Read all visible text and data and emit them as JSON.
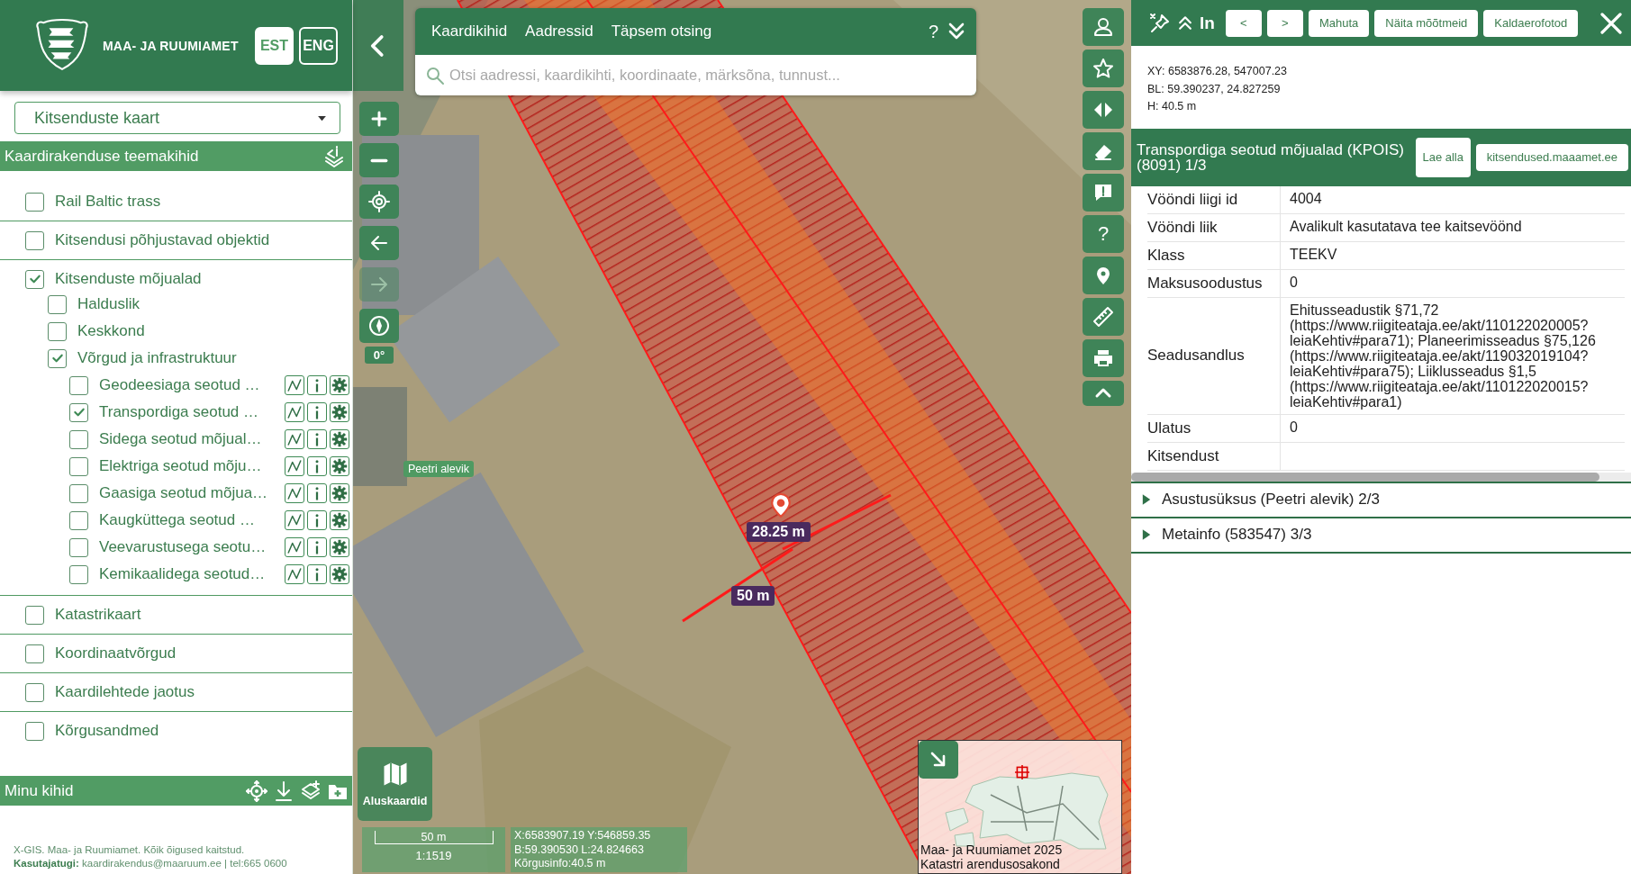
{
  "header": {
    "logo_text": "MAA- JA RUUMIAMET",
    "languages": [
      {
        "label": "EST",
        "selected": true
      },
      {
        "label": "ENG",
        "selected": false
      }
    ]
  },
  "map_selector": {
    "value": "Kitsenduste kaart"
  },
  "theme_layers": {
    "title": "Kaardirakenduse teemakihid",
    "items": [
      {
        "label": "Rail Baltic trass",
        "checked": false,
        "kind": "group"
      },
      {
        "label": "Kitsendusi põhjustavad objektid",
        "checked": false,
        "kind": "group"
      },
      {
        "label": "Kitsenduste mõjualad",
        "checked": true,
        "kind": "group",
        "children": [
          {
            "label": "Halduslik",
            "checked": false,
            "kind": "group"
          },
          {
            "label": "Keskkond",
            "checked": false,
            "kind": "group"
          },
          {
            "label": "Võrgud ja infrastruktuur",
            "checked": true,
            "kind": "group",
            "children": [
              {
                "label": "Geodeesiaga seotud …",
                "checked": false,
                "kind": "layer"
              },
              {
                "label": "Transpordiga seotud …",
                "checked": true,
                "kind": "layer"
              },
              {
                "label": "Sidega seotud mõjual…",
                "checked": false,
                "kind": "layer"
              },
              {
                "label": "Elektriga seotud mõju…",
                "checked": false,
                "kind": "layer"
              },
              {
                "label": "Gaasiga seotud mõjua…",
                "checked": false,
                "kind": "layer"
              },
              {
                "label": "Kaugküttega seotud …",
                "checked": false,
                "kind": "layer"
              },
              {
                "label": "Veevarustusega seotu…",
                "checked": false,
                "kind": "layer"
              },
              {
                "label": "Kemikaalidega seotud…",
                "checked": false,
                "kind": "layer"
              }
            ]
          }
        ]
      },
      {
        "label": "Katastrikaart",
        "checked": false,
        "kind": "group"
      },
      {
        "label": "Koordinaatvõrgud",
        "checked": false,
        "kind": "group"
      },
      {
        "label": "Kaardilehtede jaotus",
        "checked": false,
        "kind": "group"
      },
      {
        "label": "Kõrgusandmed",
        "checked": false,
        "kind": "group"
      }
    ]
  },
  "my_layers": {
    "title": "Minu kihid"
  },
  "footer": {
    "copyright": "X-GIS. Maa- ja Ruumiamet. Kõik õigused kaitstud.",
    "support": "**Kasutajatugi:** kaardirakendus@maaruum.ee | tel:665 0600"
  },
  "search": {
    "tabs": [
      "Kaardikihid",
      "Aadressid",
      "Täpsem otsing"
    ],
    "help": "?",
    "placeholder": "Otsi aadressi, kaardikihti, koordinaate, märksõna, tunnust..."
  },
  "map": {
    "rotation": "0°",
    "forward_disabled": true,
    "tools_help": "?",
    "labels": [
      {
        "kind": "place",
        "text": "Peetri alevik"
      },
      {
        "kind": "measure",
        "text": "28.25 m"
      },
      {
        "kind": "measure",
        "text": "50 m"
      }
    ],
    "basemap_button": "Aluskaardid",
    "scale": {
      "distance": "50 m",
      "ratio": "1:1519"
    },
    "cursor_coords": [
      "X:6583907.19 Y:546859.35",
      "B:59.390530 L:24.824663",
      "Kõrgusinfo:40.5 m"
    ],
    "minimap_credits": [
      "Maa- ja Ruumiamet 2025",
      "Katastri arendusosakond"
    ]
  },
  "info_panel": {
    "title": "In",
    "buttons": [
      "<",
      ">",
      "Mahuta",
      "Näita mõõtmeid",
      "Kaldaerofotod"
    ],
    "coordinates": [
      "XY: 6583876.28, 547007.23",
      "BL: 59.390237, 24.827259",
      "H: 40.5 m"
    ],
    "feature": {
      "title": "Transpordiga seotud mõjualad (KPOIS) (8091) 1/3",
      "buttons": [
        "Lae alla",
        "kitsendused.maaamet.ee"
      ],
      "attributes": [
        {
          "name": "Vööndi liigi id",
          "value": "4004"
        },
        {
          "name": "Vööndi liik",
          "value": "Avalikult kasutatava tee kaitsevöönd"
        },
        {
          "name": "Klass",
          "value": "TEEKV"
        },
        {
          "name": "Maksusoodustus",
          "value": "0"
        },
        {
          "name": "Seadusandlus",
          "value": "Ehitusseadustik §71,72 (https://www.riigiteataja.ee/akt/110122020005?leiaKehtiv#para71); Planeerimisseadus §75,126 (https://www.riigiteataja.ee/akt/119032019104?leiaKehtiv#para75); Liiklusseadus §1,5 (https://www.riigiteataja.ee/akt/110122020015?leiaKehtiv#para1)"
        },
        {
          "name": "Ulatus",
          "value": "0"
        },
        {
          "name": "Kitsendust"
        }
      ]
    },
    "sections": [
      {
        "title": "Asustusüksus (Peetri alevik) 2/3",
        "expanded": false
      },
      {
        "title": "Metainfo (583547) 3/3",
        "expanded": false
      }
    ]
  }
}
